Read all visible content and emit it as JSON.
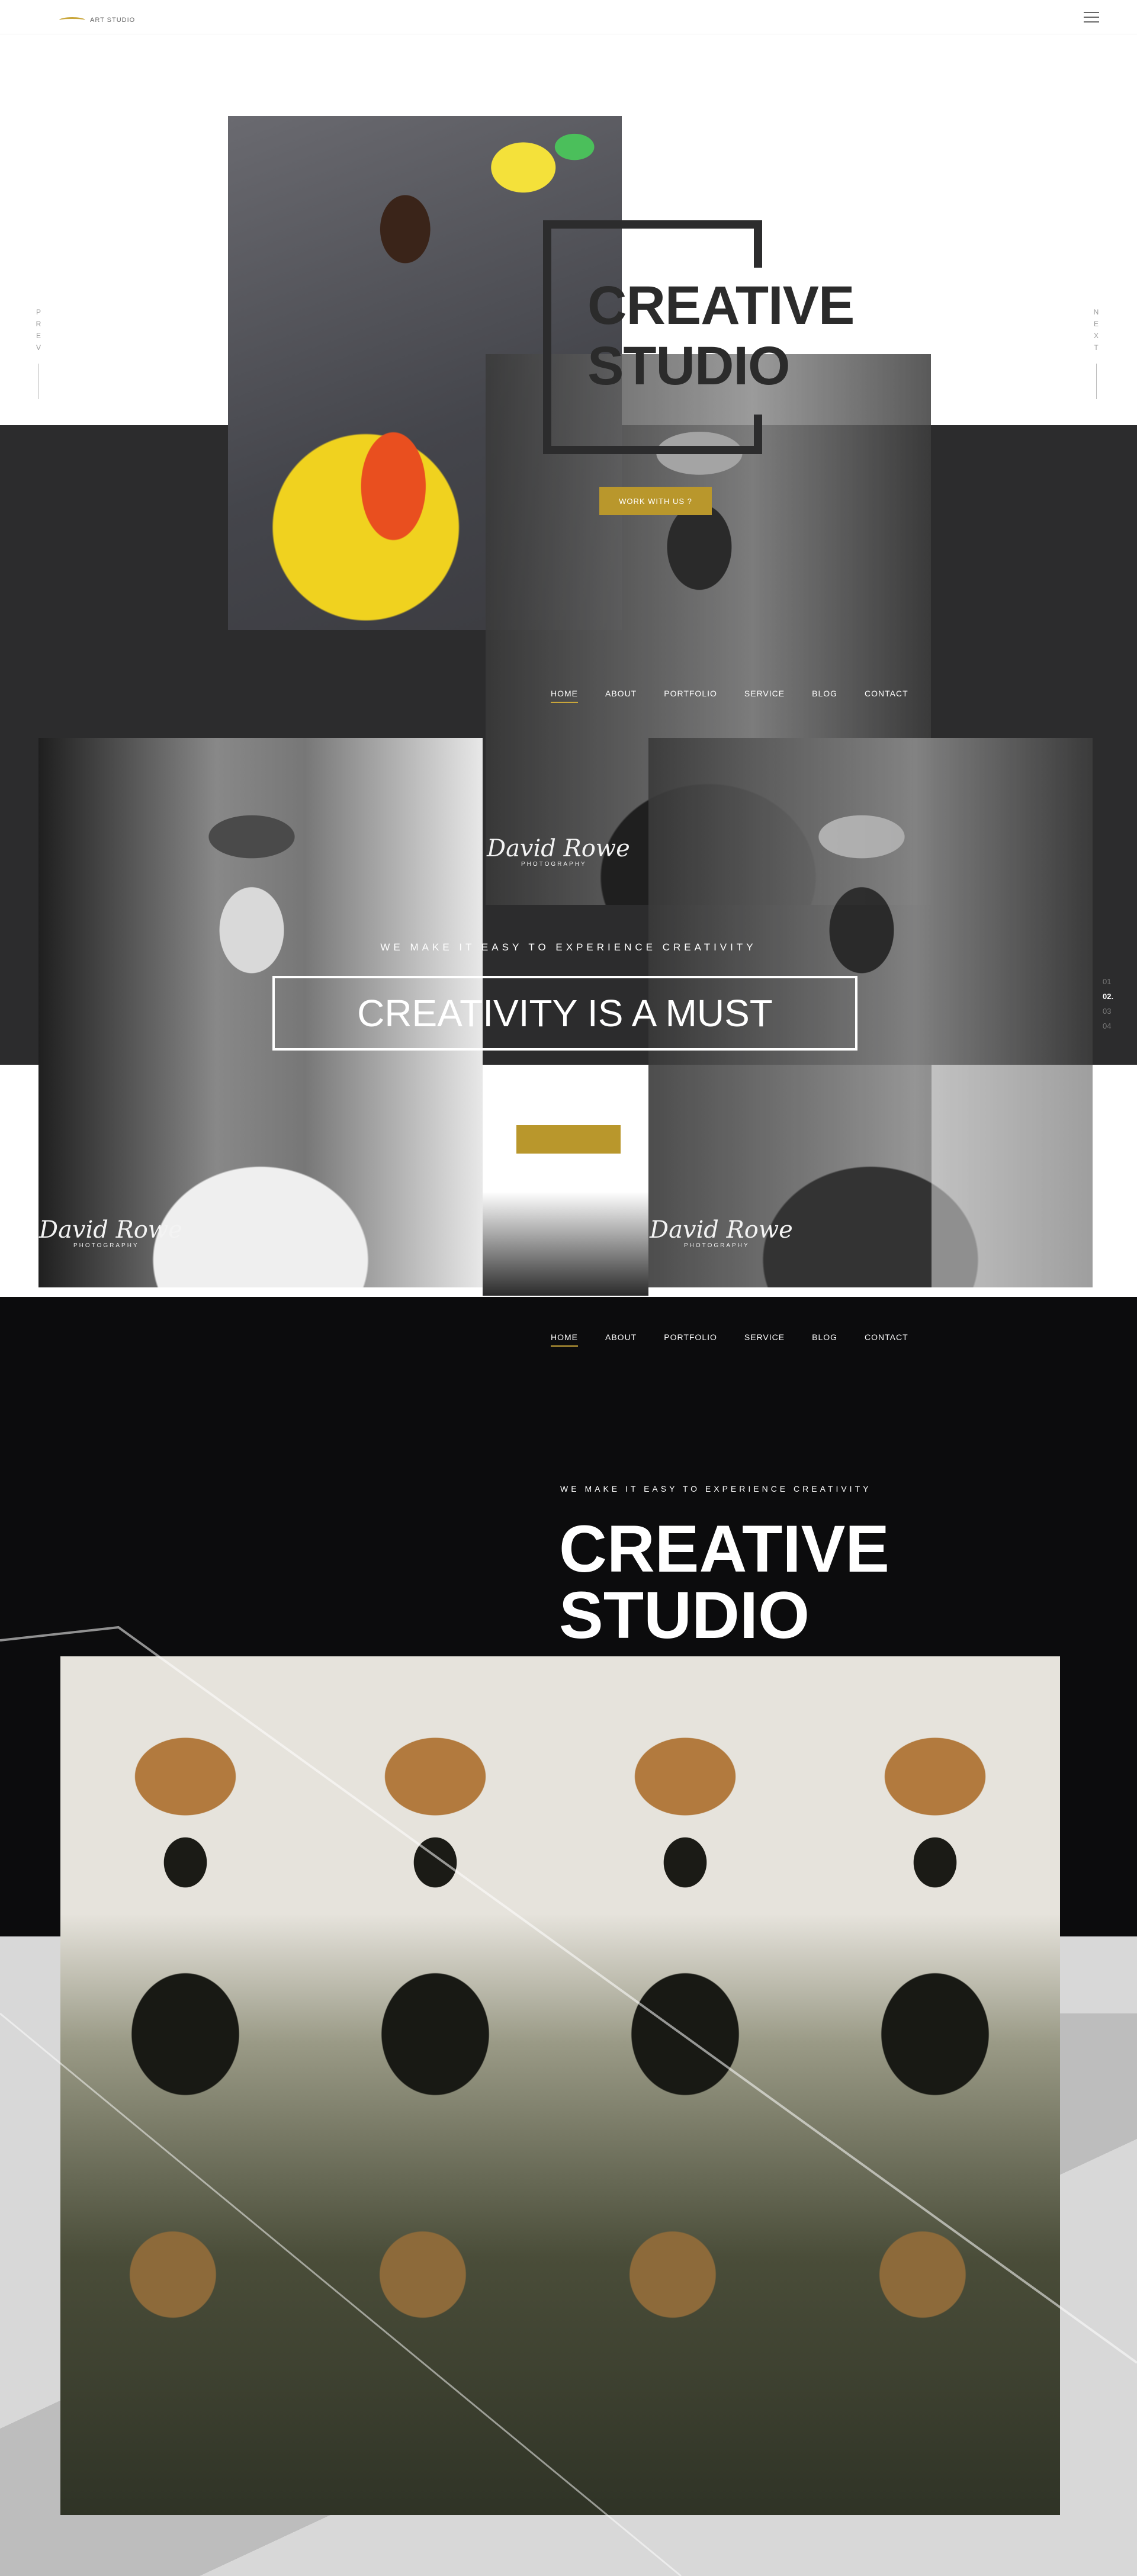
{
  "header": {
    "logo_text": "ART STUDIO",
    "menu_icon": "hamburger-icon"
  },
  "side_nav": {
    "prev": "PREV",
    "next": "NEXT"
  },
  "hero1": {
    "title_line1": "CREATIVE",
    "title_line2": "STUDIO",
    "cta": "WORK WITH US ?"
  },
  "nav": {
    "items": [
      "HOME",
      "ABOUT",
      "PORTFOLIO",
      "SERVICE",
      "BLOG",
      "CONTACT"
    ]
  },
  "watermark": {
    "name": "David Rowe",
    "sub": "PHOTOGRAPHY"
  },
  "hero2": {
    "tagline": "WE MAKE IT EASY TO EXPERIENCE CREATIVITY",
    "headline": "CREATIVITY IS A MUST"
  },
  "pager": {
    "items": [
      "01",
      "02.",
      "03",
      "04"
    ]
  },
  "hero3": {
    "tagline": "WE MAKE IT EASY TO EXPERIENCE CREATIVITY",
    "title_line1": "CREATIVE",
    "title_line2": "STUDIO"
  },
  "colors": {
    "accent": "#c9a63a",
    "button": "#b9972c",
    "dark": "#2c2c2d",
    "night": "#0e0e0f"
  }
}
